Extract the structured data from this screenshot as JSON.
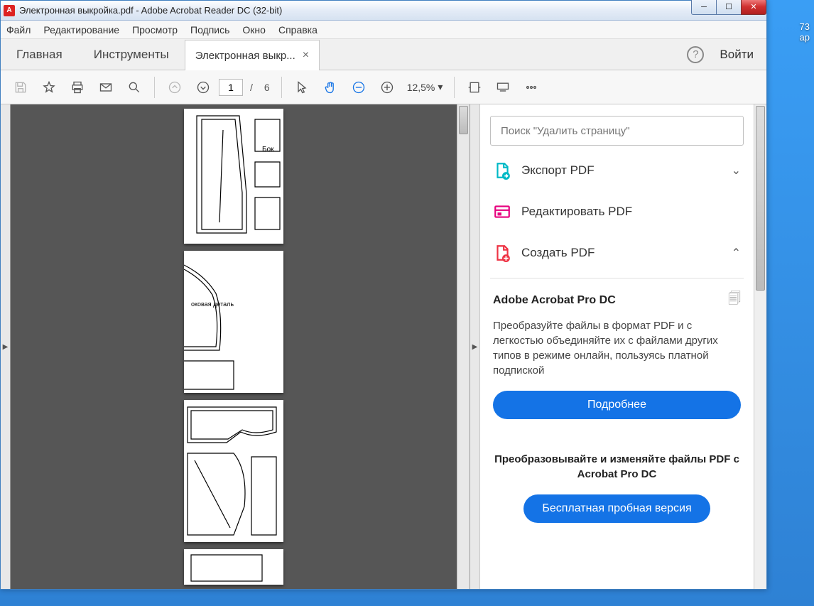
{
  "window": {
    "title": "Электронная выкройка.pdf - Adobe Acrobat Reader DC (32-bit)"
  },
  "menu": {
    "file": "Файл",
    "edit": "Редактирование",
    "view": "Просмотр",
    "sign": "Подпись",
    "window": "Окно",
    "help": "Справка"
  },
  "tabs": {
    "home": "Главная",
    "tools": "Инструменты",
    "doc": "Электронная выкр...",
    "close": "×"
  },
  "topright": {
    "login": "Войти"
  },
  "toolbar": {
    "page_current": "1",
    "page_total": "6",
    "page_sep": "/",
    "zoom": "12,5%"
  },
  "search": {
    "placeholder": "Поиск \"Удалить страницу\""
  },
  "tools_list": {
    "export": "Экспорт PDF",
    "edit": "Редактировать PDF",
    "create": "Создать PDF"
  },
  "promo": {
    "title": "Adobe Acrobat Pro DC",
    "text": "Преобразуйте файлы в формат PDF и с легкостью объединяйте их с файлами других типов в режиме онлайн, пользуясь платной подпиской",
    "btn": "Подробнее"
  },
  "promo2": {
    "title": "Преобразовывайте и изменяйте файлы PDF с Acrobat Pro DC",
    "btn": "Бесплатная пробная версия"
  },
  "page_labels": {
    "p1": "Бок",
    "p2": "оковая деталь"
  },
  "desktop": {
    "line1": "73",
    "line2": "ap"
  }
}
